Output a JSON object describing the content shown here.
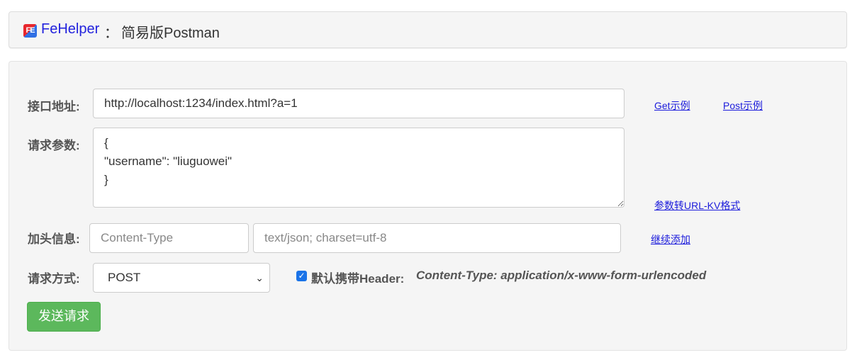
{
  "header": {
    "logo_text": "FE",
    "brand": "FeHelper",
    "separator": "：",
    "title": "简易版Postman"
  },
  "form": {
    "url": {
      "label": "接口地址:",
      "value": "http://localhost:1234/index.html?a=1"
    },
    "examples": {
      "get_label": "Get示例",
      "post_label": "Post示例"
    },
    "params": {
      "label": "请求参数:",
      "value": "{\n\"username\": \"liuguowei\"\n}",
      "convert_label": "参数转URL-KV格式"
    },
    "headers": {
      "label": "加头信息:",
      "key_placeholder": "Content-Type",
      "value_placeholder": "text/json; charset=utf-8",
      "add_label": "继续添加"
    },
    "method": {
      "label": "请求方式:",
      "selected": "POST",
      "default_header_checked": true,
      "default_header_label": "默认携带Header:",
      "default_header_value": "Content-Type: application/x-www-form-urlencoded"
    },
    "send_label": "发送请求"
  },
  "colors": {
    "brand_link": "#2222dd",
    "send_button": "#5cb85c",
    "checkbox": "#1a73e8",
    "link": "#1a1adb"
  }
}
